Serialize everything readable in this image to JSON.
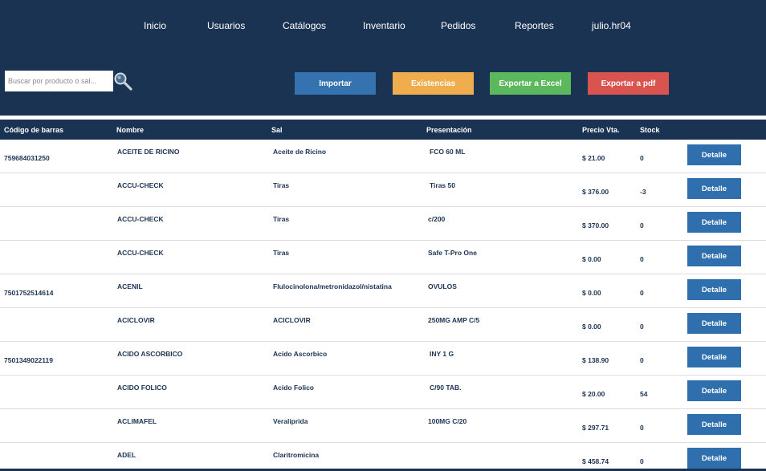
{
  "nav": {
    "inicio": "Inicio",
    "usuarios": "Usuarios",
    "catalogos": "Catálogos",
    "inventario": "Inventario",
    "pedidos": "Pedidos",
    "reportes": "Reportes",
    "user": "julio.hr04"
  },
  "search": {
    "placeholder": "Buscar por producto o sal...",
    "value": ""
  },
  "actions": {
    "importar": "Importar",
    "existencias": "Existencias",
    "exportar_excel": "Exportar a Excel",
    "exportar_pdf": "Exportar a pdf"
  },
  "colors": {
    "header": "#1b3353",
    "importar": "#3572b0",
    "existencias": "#f0ad4e",
    "exportar_excel": "#5cb85c",
    "exportar_pdf": "#d9534f",
    "detalle": "#2f6fad"
  },
  "table": {
    "headers": {
      "codigo": "Código de barras",
      "nombre": "Nombre",
      "sal": "Sal",
      "presentacion": "Presentación",
      "precio": "Precio Vta.",
      "stock": "Stock"
    },
    "detalle_label": "Detalle",
    "rows": [
      {
        "codigo": "759684031250",
        "nombre": "ACEITE DE RICINO",
        "sal": "Aceite de Ricino",
        "presentacion": "FCO 60 ML",
        "precio": "$ 21.00",
        "stock": "0"
      },
      {
        "codigo": "",
        "nombre": "ACCU-CHECK",
        "sal": "Tiras",
        "presentacion": "Tiras 50",
        "precio": "$ 376.00",
        "stock": "-3"
      },
      {
        "codigo": "",
        "nombre": "ACCU-CHECK",
        "sal": "Tiras",
        "presentacion": "c/200",
        "precio": "$ 370.00",
        "stock": "0"
      },
      {
        "codigo": "",
        "nombre": "ACCU-CHECK",
        "sal": "Tiras",
        "presentacion": "Safe T-Pro One",
        "precio": "$ 0.00",
        "stock": "0"
      },
      {
        "codigo": "7501752514614",
        "nombre": "ACENIL",
        "sal": "Flulocinolona/metronidazol/nistatina",
        "presentacion": "OVULOS",
        "precio": "$ 0.00",
        "stock": "0"
      },
      {
        "codigo": "",
        "nombre": "ACICLOVIR",
        "sal": "ACICLOVIR",
        "presentacion": "250MG AMP C/5",
        "precio": "$ 0.00",
        "stock": "0"
      },
      {
        "codigo": "7501349022119",
        "nombre": "ACIDO ASCORBICO",
        "sal": "Acido Ascorbico",
        "presentacion": "INY 1 G",
        "precio": "$ 138.90",
        "stock": "0"
      },
      {
        "codigo": "",
        "nombre": "ACIDO FOLICO",
        "sal": "Acido Folico",
        "presentacion": "C/90 TAB.",
        "precio": "$ 20.00",
        "stock": "54"
      },
      {
        "codigo": "",
        "nombre": "ACLIMAFEL",
        "sal": "Veraliprida",
        "presentacion": "100MG C/20",
        "precio": "$ 297.71",
        "stock": "0"
      },
      {
        "codigo": "",
        "nombre": "ADEL",
        "sal": "Claritromicina",
        "presentacion": "",
        "precio": "$ 458.74",
        "stock": "0"
      }
    ]
  }
}
